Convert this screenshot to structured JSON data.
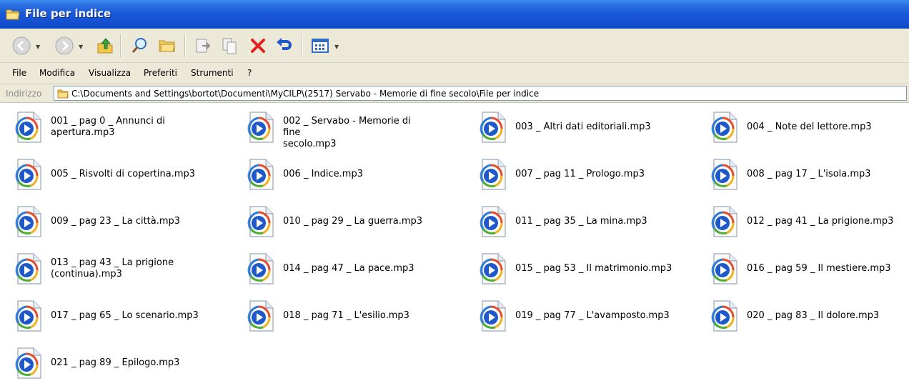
{
  "window": {
    "title": "File per indice"
  },
  "toolbar": {
    "buttons": [
      {
        "name": "back",
        "icon": "back-arrow-icon"
      },
      {
        "name": "forward",
        "icon": "forward-arrow-icon"
      },
      {
        "name": "up",
        "icon": "folder-up-icon"
      },
      {
        "name": "search",
        "icon": "search-icon"
      },
      {
        "name": "folders",
        "icon": "folders-icon"
      },
      {
        "name": "move-to",
        "icon": "move-to-icon"
      },
      {
        "name": "copy-to",
        "icon": "copy-to-icon"
      },
      {
        "name": "delete",
        "icon": "delete-icon"
      },
      {
        "name": "undo",
        "icon": "undo-icon"
      },
      {
        "name": "views",
        "icon": "views-icon"
      }
    ]
  },
  "menu": [
    "File",
    "Modifica",
    "Visualizza",
    "Preferiti",
    "Strumenti",
    "?"
  ],
  "address": {
    "label": "Indirizzo",
    "path": "C:\\Documents and Settings\\bortot\\Documenti\\MyCILP\\(2517) Servabo - Memorie di fine secolo\\File per indice"
  },
  "files": [
    {
      "line1": "001 _ pag 0 _ Annunci di",
      "line2": "apertura.mp3"
    },
    {
      "line1": "002 _ Servabo - Memorie di fine",
      "line2": "secolo.mp3"
    },
    {
      "line1": "003 _ Altri dati editoriali.mp3"
    },
    {
      "line1": "004 _ Note del lettore.mp3"
    },
    {
      "line1": "005 _ Risvolti di copertina.mp3"
    },
    {
      "line1": "006 _ Indice.mp3"
    },
    {
      "line1": "007 _ pag 11 _ Prologo.mp3"
    },
    {
      "line1": "008 _ pag 17 _ L'isola.mp3"
    },
    {
      "line1": "009 _ pag 23 _ La città.mp3"
    },
    {
      "line1": "010 _ pag 29 _ La guerra.mp3"
    },
    {
      "line1": "011 _ pag 35 _ La mina.mp3"
    },
    {
      "line1": "012 _ pag 41 _ La prigione.mp3"
    },
    {
      "line1": "013 _ pag 43 _ La prigione",
      "line2": "(continua).mp3"
    },
    {
      "line1": "014 _ pag 47 _ La pace.mp3"
    },
    {
      "line1": "015 _ pag 53 _ Il matrimonio.mp3"
    },
    {
      "line1": "016 _ pag 59 _ Il mestiere.mp3"
    },
    {
      "line1": "017 _ pag 65 _ Lo scenario.mp3"
    },
    {
      "line1": "018 _ pag 71 _ L'esilio.mp3"
    },
    {
      "line1": "019 _ pag 77 _ L'avamposto.mp3"
    },
    {
      "line1": "020 _ pag 83 _ Il dolore.mp3"
    },
    {
      "line1": "021 _ pag 89 _ Epilogo.mp3"
    }
  ],
  "colors": {
    "titlebar": "#1858d6",
    "chrome": "#ece9d8",
    "accent_blue": "#1f58c8"
  }
}
